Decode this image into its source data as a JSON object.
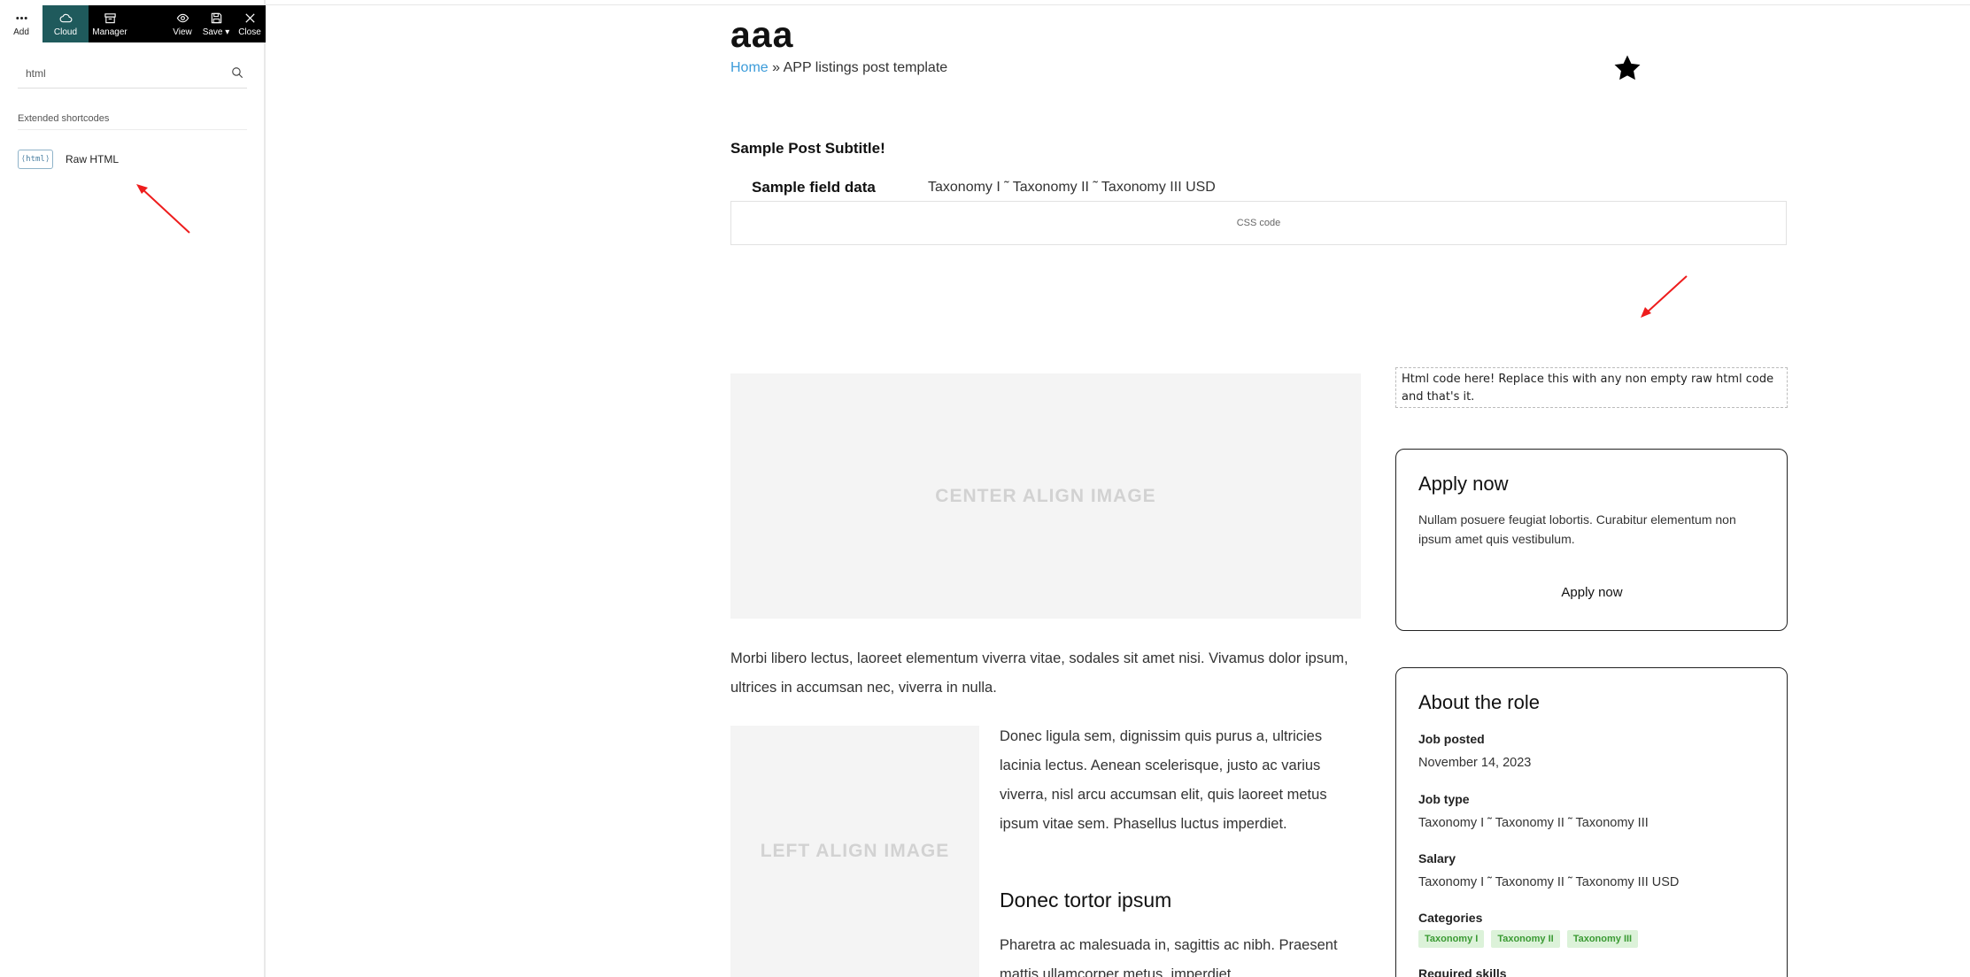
{
  "toolbar": {
    "add": "Add",
    "cloud": "Cloud",
    "manager": "Manager",
    "view": "View",
    "save": "Save ▾",
    "close": "Close"
  },
  "search": {
    "value": "html"
  },
  "panel": {
    "section_title": "Extended shortcodes",
    "item_badge": "⟨html⟩",
    "item_label": "Raw HTML"
  },
  "post": {
    "title": "aaa",
    "breadcrumb_home": "Home",
    "breadcrumb_sep": " » ",
    "breadcrumb_current": "APP listings post template",
    "subtitle": "Sample Post Subtitle!",
    "field_label": "Sample field data",
    "field_value": "Taxonomy I ˜ Taxonomy II ˜ Taxonomy III USD",
    "css_box": "CSS code",
    "center_image": "CENTER ALIGN IMAGE",
    "left_image": "LEFT ALIGN IMAGE",
    "para_1": "Morbi libero lectus, laoreet elementum viverra vitae, sodales sit amet nisi. Vivamus dolor ipsum, ultrices in accumsan nec, viverra in nulla.",
    "para_2": "Donec ligula sem, dignissim quis purus a, ultricies lacinia lectus. Aenean scelerisque, justo ac varius viverra, nisl arcu accumsan elit, quis laoreet metus ipsum vitae sem. Phasellus luctus imperdiet.",
    "heading_2": "Donec tortor ipsum",
    "para_3": "Pharetra ac malesuada in, sagittis ac nibh. Praesent mattis ullamcorper metus, imperdiet"
  },
  "sidebar": {
    "html_box": "Html code here! Replace this with any non empty raw html code and that's it.",
    "apply": {
      "title": "Apply now",
      "text": "Nullam posuere feugiat lobortis. Curabitur elementum non ipsum amet quis vestibulum.",
      "button": "Apply now"
    },
    "role": {
      "title": "About the role",
      "job_posted_label": "Job posted",
      "job_posted_value": "November 14, 2023",
      "job_type_label": "Job type",
      "job_type_value": "Taxonomy I ˜ Taxonomy II ˜ Taxonomy III",
      "salary_label": "Salary",
      "salary_value": "Taxonomy I ˜ Taxonomy II ˜ Taxonomy III USD",
      "categories_label": "Categories",
      "tags": [
        "Taxonomy I",
        "Taxonomy II",
        "Taxonomy III"
      ],
      "skills_label": "Required skills"
    }
  },
  "colors": {
    "cloud_active": "#1f5a5c",
    "toolbar_bg": "#000000",
    "link": "#3b9bd9",
    "tag_bg": "#dcf2d9",
    "tag_text": "#3a9a33",
    "annotation_arrow": "#ee1c1c"
  },
  "icons": {
    "add": "dots-icon",
    "cloud": "cloud-icon",
    "manager": "archive-icon",
    "view": "eye-icon",
    "save": "floppy-icon",
    "close": "close-icon",
    "search": "search-icon",
    "favorite": "star-icon"
  }
}
